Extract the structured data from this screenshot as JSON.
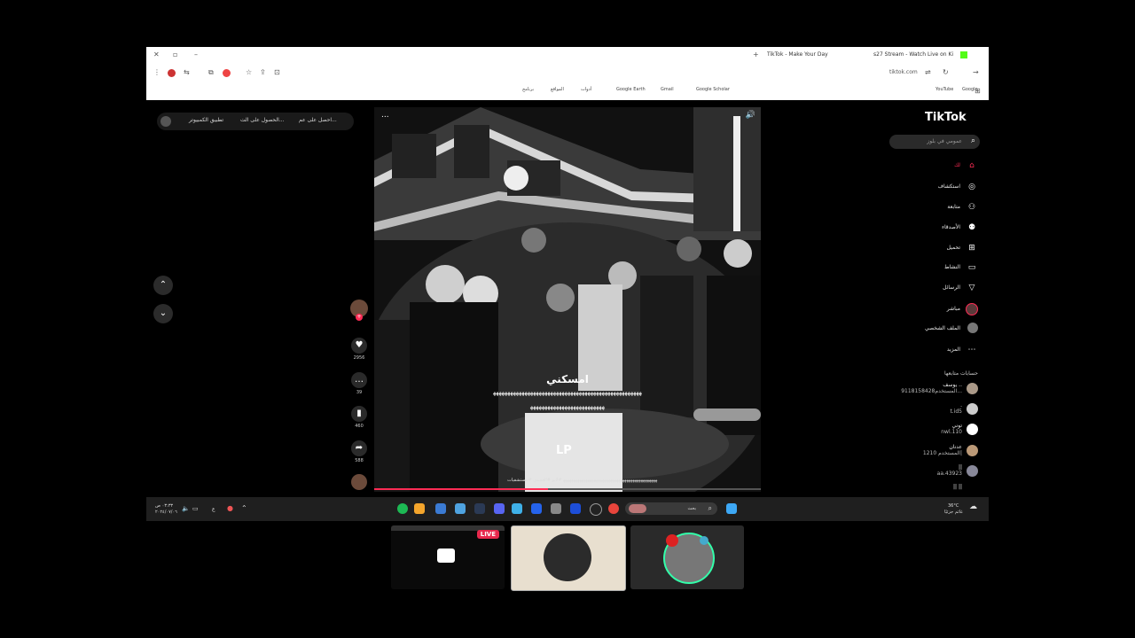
{
  "browser": {
    "tabs": [
      "TikTok - Make Your Day",
      "s27 Stream - Watch Live on Ki"
    ],
    "new_tab": "+",
    "address": "tiktok.com",
    "bookmarks": [
      "Google",
      "Gmail",
      "YouTube",
      "Google Scholar",
      "Google Earth",
      "أدوات",
      "المواقع",
      "برنامج"
    ]
  },
  "topbar": {
    "links": [
      "احصل على عم...",
      "الحصول على الت...",
      "تطبيق الكمبيوتر"
    ]
  },
  "video": {
    "caption_main": "امسكني",
    "caption_line2": "ﻬﻬﻬﻬﻬﻬﻬﻬﻬﻬﻬﻬﻬﻬﻬﻬﻬﻬﻬﻬﻬﻬﻬﻬﻬﻬﻬﻬﻬﻬﻬﻬﻬﻬﻬﻬﻬﻬﻬﻬﻬﻬﻬﻬﻬﻬﻬﻬﻬﻬﻬﻬ",
    "caption_line3": "ﻬﻬﻬﻬﻬﻬﻬﻬﻬﻬﻬﻬﻬﻬﻬﻬﻬﻬﻬﻬﻬﻬﻬﻬﻬﻬ",
    "overlay_text": "LP",
    "description": "ﻬﻬﻬﻬﻬﻬﻬﻬﻬﻬﻬﻬﻬﻬﻬﻬﻬﻬﻬﻬﻬﻬﻬﻬﻬﻬﻬﻬﻬﻬﻬﻬﻬﻬﻬﻬﻬﻬﻬﻬﻬﻬﻬﻬﻬﻬ #لايو #العجمي #مستشفيات",
    "progress": 0.45,
    "menu_icon": "...",
    "volume_icon": "🔊"
  },
  "actions": {
    "likes": "2956",
    "comments": "39",
    "saves": "460",
    "shares": "588"
  },
  "nav_arrows": {
    "up": "⌃",
    "down": "⌄"
  },
  "sidebar": {
    "logo": "TikTok",
    "search_placeholder": "عمومي في بلوز",
    "items": [
      {
        "label": "لك",
        "icon": "home-icon"
      },
      {
        "label": "استكشاف",
        "icon": "compass-icon"
      },
      {
        "label": "متابعة",
        "icon": "user-follow-icon"
      },
      {
        "label": "الأصدقاء",
        "icon": "friends-icon"
      },
      {
        "label": "تحميل",
        "icon": "upload-icon"
      },
      {
        "label": "النشاط",
        "icon": "activity-icon"
      },
      {
        "label": "الرسائل",
        "icon": "messages-icon"
      },
      {
        "label": "مباشر",
        "icon": "live-icon"
      },
      {
        "label": "الملف الشخصي",
        "icon": "profile-icon"
      },
      {
        "label": "المزيد",
        "icon": "more-icon"
      }
    ],
    "following_header": "حسابات متابعها",
    "accounts": [
      {
        "name": "يوسف ..",
        "handle": "المستخدم9118158428..."
      },
      {
        "name": ".",
        "handle": "t.id5"
      },
      {
        "name": "توني",
        "handle": "nwl.110"
      },
      {
        "name": "عدنان",
        "handle": "المستخدم 1210|"
      },
      {
        "name": "||",
        "handle": "aa.43923"
      },
      {
        "name": "|| ||",
        "handle": ""
      }
    ]
  },
  "taskbar": {
    "time": "٠٣:٣٣ ص",
    "date": "٢٠٢٤/٠٧/٠٦",
    "lang": "ع",
    "search_label": "بحث",
    "weather_temp": "36°C",
    "weather_desc": "غائم جزئيًا"
  },
  "thumbnails": {
    "live_label": "LIVE"
  },
  "colors": {
    "accent": "#fe2c55",
    "live": "#e8294d"
  }
}
